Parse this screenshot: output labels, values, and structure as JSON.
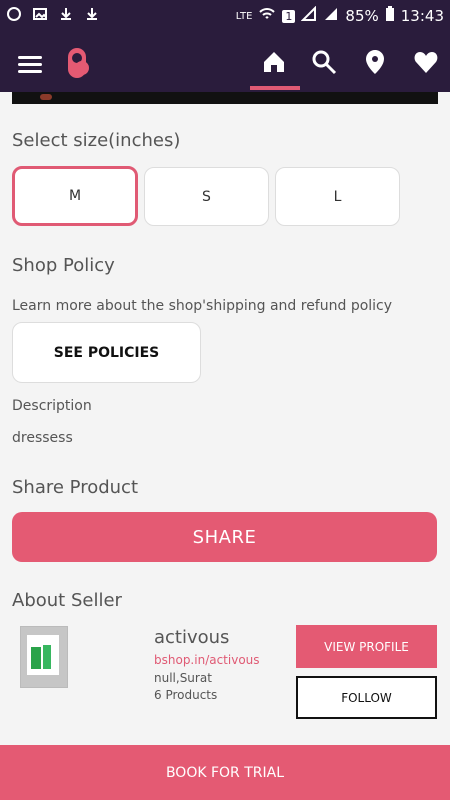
{
  "status": {
    "battery": "85%",
    "time": "13:43",
    "sim_badge": "1",
    "network_label": "LTE"
  },
  "header": {},
  "size_section": {
    "title": "Select size(inches)",
    "options": [
      "M",
      "S",
      "L"
    ],
    "selected": "M"
  },
  "policy": {
    "title": "Shop Policy",
    "text": "Learn more about the shop'shipping and refund policy",
    "button": "SEE POLICIES"
  },
  "description": {
    "label": "Description",
    "value": "dressess"
  },
  "share": {
    "title": "Share Product",
    "button": "SHARE"
  },
  "seller": {
    "title": "About Seller",
    "name": "activous",
    "link": "bshop.in/activous",
    "location": "null,Surat",
    "products": "6 Products",
    "view_profile": "VIEW PROFILE",
    "follow": "FOLLOW"
  },
  "bottom_action": "BOOK FOR TRIAL",
  "colors": {
    "accent": "#e45a73",
    "header_bg": "#2a1c3c",
    "page_bg": "#f4f4f4"
  }
}
